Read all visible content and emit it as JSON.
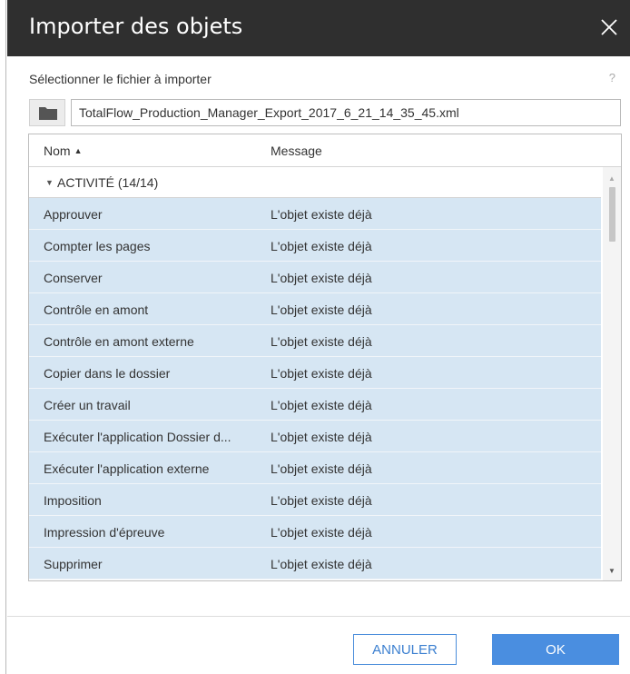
{
  "dialog": {
    "title": "Importer des objets",
    "close_icon": "close-icon"
  },
  "file_section": {
    "label": "Sélectionner le fichier à importer",
    "help_text": "?",
    "folder_icon": "folder-icon",
    "file_value": "TotalFlow_Production_Manager_Export_2017_6_21_14_35_45.xml"
  },
  "table": {
    "columns": {
      "name": "Nom",
      "message": "Message"
    },
    "sort_indicator": "▲",
    "group": {
      "caret": "▼",
      "label": "ACTIVITÉ (14/14)"
    },
    "rows": [
      {
        "name": "Approuver",
        "message": "L'objet existe déjà"
      },
      {
        "name": "Compter les pages",
        "message": "L'objet existe déjà"
      },
      {
        "name": "Conserver",
        "message": "L'objet existe déjà"
      },
      {
        "name": "Contrôle en amont",
        "message": "L'objet existe déjà"
      },
      {
        "name": "Contrôle en amont externe",
        "message": "L'objet existe déjà"
      },
      {
        "name": "Copier dans le dossier",
        "message": "L'objet existe déjà"
      },
      {
        "name": "Créer un travail",
        "message": "L'objet existe déjà"
      },
      {
        "name": "Exécuter l'application Dossier d...",
        "message": "L'objet existe déjà"
      },
      {
        "name": "Exécuter l'application externe",
        "message": "L'objet existe déjà"
      },
      {
        "name": "Imposition",
        "message": "L'objet existe déjà"
      },
      {
        "name": "Impression d'épreuve",
        "message": "L'objet existe déjà"
      },
      {
        "name": "Supprimer",
        "message": "L'objet existe déjà"
      }
    ],
    "selected_row_color": "#d6e6f3"
  },
  "buttons": {
    "cancel": "ANNULER",
    "ok": "OK"
  },
  "colors": {
    "titlebar": "#2f2f2f",
    "accent": "#4a8ee0"
  }
}
